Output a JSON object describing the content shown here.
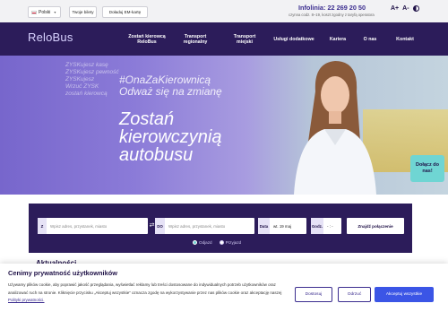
{
  "topbar": {
    "language": "Polski",
    "btn_tickets": "Twoje bilety",
    "btn_card": "Doładuj EM-kartę",
    "infoline_label": "Infolinia:",
    "infoline_number": "22 269 20 50",
    "hours": "czynna codz. 8–19, koszt zgodny z taryfą operatora",
    "font_up": "A+",
    "font_down": "A-"
  },
  "nav": {
    "logo": "ReloBus",
    "items": [
      {
        "label": "Zostań kierowcą ReloBus"
      },
      {
        "label": "Transport regionalny"
      },
      {
        "label": "Transport miejski"
      },
      {
        "label": "Usługi dodatkowe"
      },
      {
        "label": "Kariera"
      },
      {
        "label": "O nas"
      },
      {
        "label": "Kontakt"
      }
    ]
  },
  "hero": {
    "bg_lines": "ZYSKujesz kasę\nZYSKujesz pewność\nZYSKujesz\nWrzuć ZYSK\nzostań kierowcą",
    "hashtag": "#OnaZaKierownicą",
    "slogan": "Odważ się na zmianę",
    "title": "Zostań kierowczynią autobusu",
    "cta": "Dołącz do nas!"
  },
  "search": {
    "from_prefix": "Z",
    "from_placeholder": "Wpisz adres, przystanek, miasto",
    "to_prefix": "DO",
    "to_placeholder": "Wpisz adres, przystanek, miasto",
    "date_label": "Data",
    "date_value": "wt. 19 maj",
    "time_label": "Godz.",
    "time_value": "- : -",
    "find_button": "Znajdź połączenie",
    "radio_departure": "Odjazd",
    "radio_arrival": "Przyjazd"
  },
  "behind_text": "Aktualności",
  "cookie": {
    "title": "Cenimy prywatność użytkowników",
    "text": "Używamy plików cookie, aby poprawić jakość przeglądania, wyświetlać reklamy lub treści dostosowane do indywidualnych potrzeb użytkowników oraz analizować ruch na stronie. Kliknięcie przycisku „Akceptuj wszystkie” oznacza zgodę na wykorzystywanie przez nas plików cookie oraz akceptację naszej",
    "link": "Polityki prywatności.",
    "btn_customize": "Dostosuj",
    "btn_reject": "Odrzuć",
    "btn_accept": "Akceptuj wszystkie"
  },
  "colors": {
    "brand_dark": "#2c1c5a",
    "accent_teal": "#6fd5d3",
    "accept_blue": "#3b55e6"
  }
}
